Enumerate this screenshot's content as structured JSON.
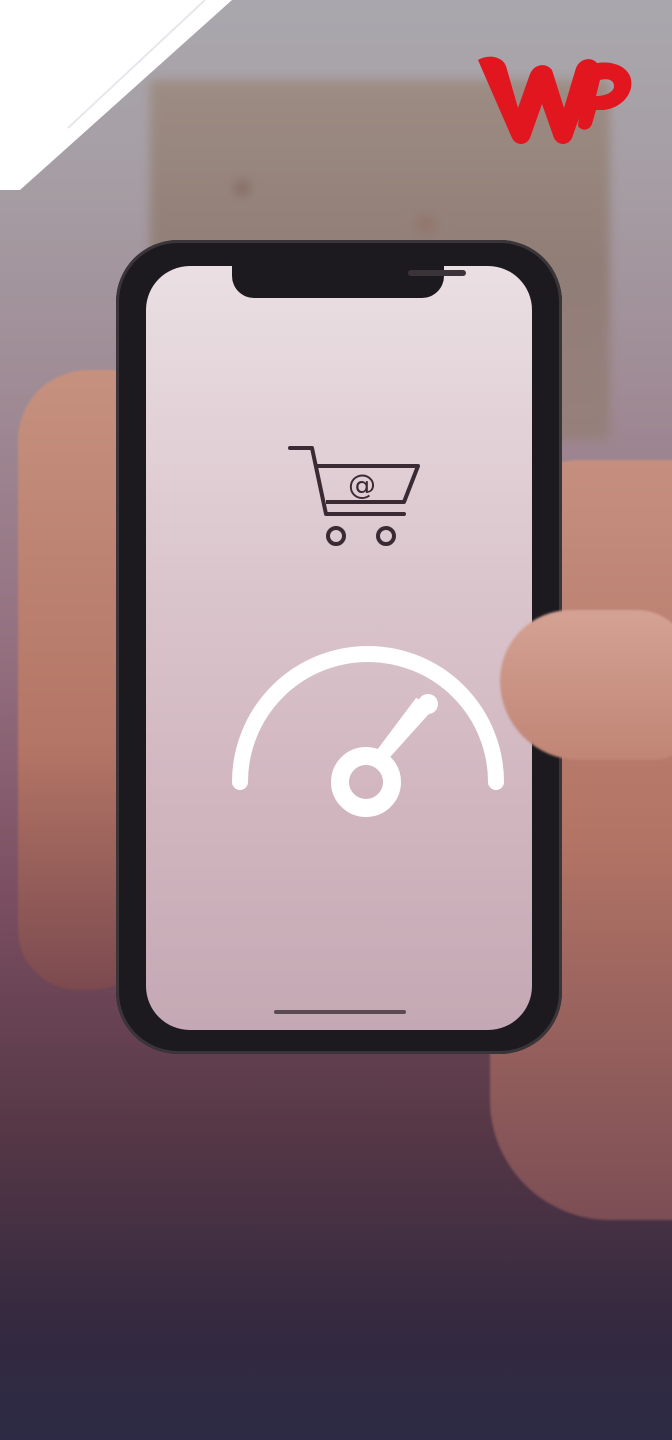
{
  "brand": {
    "logo_text": "WP",
    "logo_color": "#e1161e"
  },
  "phone_screen": {
    "icons": [
      "shopping-cart-at-icon",
      "speedometer-gauge-icon"
    ],
    "icon_color": "#3a2a33",
    "gauge_color": "#ffffff"
  },
  "theme": {
    "top_color": "#a9a7ad",
    "bottom_color": "#2c2a45"
  }
}
